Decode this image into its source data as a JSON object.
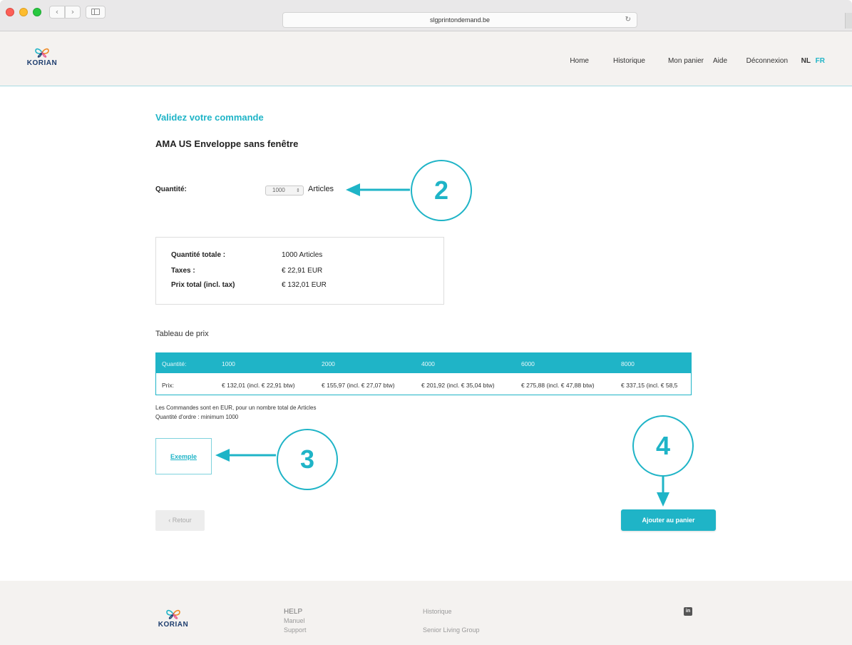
{
  "browser": {
    "url": "slgprintondemand.be",
    "back_icon": "‹",
    "forward_icon": "›",
    "reload_icon": "↻"
  },
  "header": {
    "logo_text": "KORIAN",
    "nav": [
      "Home",
      "Historique",
      "Mon panier",
      "Aide",
      "Déconnexion"
    ],
    "lang_nl": "NL",
    "lang_fr": "FR"
  },
  "main": {
    "heading": "Validez votre commande",
    "product_name": "AMA US Enveloppe sans fenêtre",
    "quantity_label": "Quantité:",
    "quantity_value": "1000",
    "quantity_unit": "Articles",
    "summary": [
      {
        "label": "Quantité totale :",
        "value": "1000 Articles"
      },
      {
        "label": "Taxes :",
        "value": "€ 22,91  EUR"
      },
      {
        "label": "Prix total (incl. tax)",
        "value": "€ 132,01 EUR"
      }
    ],
    "price_table_title": "Tableau de prix",
    "price_table": {
      "header": [
        "Quantité:",
        "1000",
        "2000",
        "4000",
        "6000",
        "8000"
      ],
      "row": [
        "Prix:",
        "€ 132,01 (incl. € 22,91 btw)",
        "€ 155,97 (incl. € 27,07 btw)",
        "€ 201,92 (incl. € 35,04 btw)",
        "€ 275,88 (incl. € 47,88 btw)",
        "€ 337,15 (incl. € 58,5"
      ]
    },
    "note_1": "Les Commandes sont en EUR, pour un nombre total de Articles",
    "note_2": "Quantité d'ordre : minimum 1000",
    "example_link": "Exemple",
    "back_button": "‹ Retour",
    "cart_button": "Ajouter au panier"
  },
  "annotations": {
    "callout_2": "2",
    "callout_3": "3",
    "callout_4": "4"
  },
  "footer": {
    "logo_text": "KORIAN",
    "help_title": "HELP",
    "help_links": [
      "Manuel",
      "Support"
    ],
    "links": [
      "Historique",
      "Senior Living Group"
    ],
    "social": "in"
  },
  "colors": {
    "accent": "#1fb4c7",
    "header_bg": "#f4f2f0",
    "brand_navy": "#1d3d6e"
  }
}
